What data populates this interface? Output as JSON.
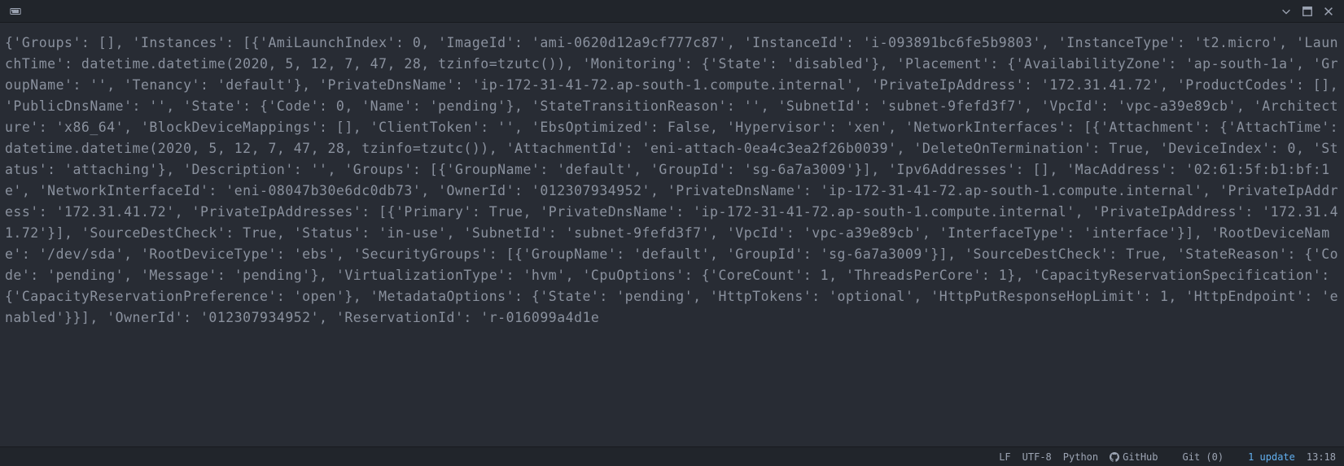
{
  "toolbar": {
    "left_icon": "keyboard-icon",
    "right_icons": [
      "chevron-down-icon",
      "maximize-icon",
      "close-icon"
    ]
  },
  "statusbar": {
    "line_ending": "LF",
    "encoding": "UTF-8",
    "language": "Python",
    "github_label": "GitHub",
    "git_label": "Git (0)",
    "update_label": "1 update",
    "time": "13:18"
  },
  "output": "{'Groups': [], 'Instances': [{'AmiLaunchIndex': 0, 'ImageId': 'ami-0620d12a9cf777c87', 'InstanceId': 'i-093891bc6fe5b9803', 'InstanceType': 't2.micro', 'LaunchTime': datetime.datetime(2020, 5, 12, 7, 47, 28, tzinfo=tzutc()), 'Monitoring': {'State': 'disabled'}, 'Placement': {'AvailabilityZone': 'ap-south-1a', 'GroupName': '', 'Tenancy': 'default'}, 'PrivateDnsName': 'ip-172-31-41-72.ap-south-1.compute.internal', 'PrivateIpAddress': '172.31.41.72', 'ProductCodes': [], 'PublicDnsName': '', 'State': {'Code': 0, 'Name': 'pending'}, 'StateTransitionReason': '', 'SubnetId': 'subnet-9fefd3f7', 'VpcId': 'vpc-a39e89cb', 'Architecture': 'x86_64', 'BlockDeviceMappings': [], 'ClientToken': '', 'EbsOptimized': False, 'Hypervisor': 'xen', 'NetworkInterfaces': [{'Attachment': {'AttachTime': datetime.datetime(2020, 5, 12, 7, 47, 28, tzinfo=tzutc()), 'AttachmentId': 'eni-attach-0ea4c3ea2f26b0039', 'DeleteOnTermination': True, 'DeviceIndex': 0, 'Status': 'attaching'}, 'Description': '', 'Groups': [{'GroupName': 'default', 'GroupId': 'sg-6a7a3009'}], 'Ipv6Addresses': [], 'MacAddress': '02:61:5f:b1:bf:1e', 'NetworkInterfaceId': 'eni-08047b30e6dc0db73', 'OwnerId': '012307934952', 'PrivateDnsName': 'ip-172-31-41-72.ap-south-1.compute.internal', 'PrivateIpAddress': '172.31.41.72', 'PrivateIpAddresses': [{'Primary': True, 'PrivateDnsName': 'ip-172-31-41-72.ap-south-1.compute.internal', 'PrivateIpAddress': '172.31.41.72'}], 'SourceDestCheck': True, 'Status': 'in-use', 'SubnetId': 'subnet-9fefd3f7', 'VpcId': 'vpc-a39e89cb', 'InterfaceType': 'interface'}], 'RootDeviceName': '/dev/sda', 'RootDeviceType': 'ebs', 'SecurityGroups': [{'GroupName': 'default', 'GroupId': 'sg-6a7a3009'}], 'SourceDestCheck': True, 'StateReason': {'Code': 'pending', 'Message': 'pending'}, 'VirtualizationType': 'hvm', 'CpuOptions': {'CoreCount': 1, 'ThreadsPerCore': 1}, 'CapacityReservationSpecification': {'CapacityReservationPreference': 'open'}, 'MetadataOptions': {'State': 'pending', 'HttpTokens': 'optional', 'HttpPutResponseHopLimit': 1, 'HttpEndpoint': 'enabled'}}], 'OwnerId': '012307934952', 'ReservationId': 'r-016099a4d1e"
}
